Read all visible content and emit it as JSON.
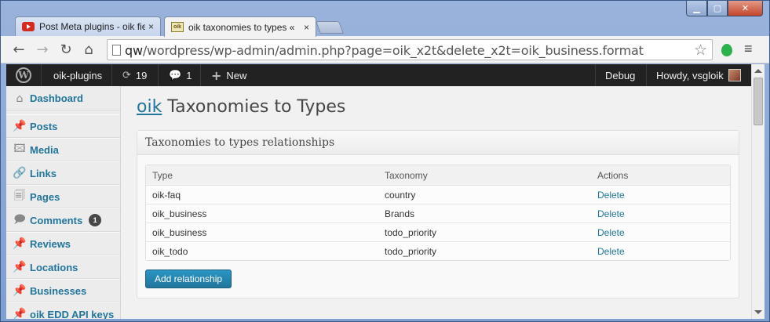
{
  "browser": {
    "tabs": [
      {
        "title": "Post Meta plugins - oik fie",
        "close": "×"
      },
      {
        "title": "oik taxonomies to types « ",
        "close": "×"
      }
    ],
    "window_controls": {
      "minimize": "▁",
      "maximize": "▢",
      "close": "✕"
    },
    "nav": {
      "back": "←",
      "forward": "→",
      "reload": "↻",
      "home": "⌂"
    },
    "address": {
      "host": "qw",
      "path": "/wordpress/wp-admin/admin.php?page=oik_x2t&delete_x2t=oik_business.format"
    },
    "star": "☆",
    "menu": "≡",
    "favicon_oik": "oik"
  },
  "adminbar": {
    "wp_logo": "W",
    "site_name": "oik-plugins",
    "updates_icon": "⟳",
    "updates_count": "19",
    "comments_icon": "💬",
    "comments_count": "1",
    "new_icon": "+",
    "new_label": "New",
    "debug": "Debug",
    "howdy": "Howdy, vsgloik"
  },
  "sidebar": {
    "items": [
      {
        "label": "Dashboard",
        "icon": "⌂"
      },
      {
        "label": "Posts",
        "icon": "📌"
      },
      {
        "label": "Media",
        "icon": "🖾"
      },
      {
        "label": "Links",
        "icon": "🔗"
      },
      {
        "label": "Pages",
        "icon": "🗐"
      },
      {
        "label": "Comments",
        "icon": "🗩",
        "badge": "1"
      },
      {
        "label": "Reviews",
        "icon": "📌"
      },
      {
        "label": "Locations",
        "icon": "📌"
      },
      {
        "label": "Businesses",
        "icon": "📌"
      },
      {
        "label": "oik EDD API keys",
        "icon": "📌"
      }
    ]
  },
  "main": {
    "title_link": "oik",
    "title_rest": " Taxonomies to Types",
    "box_title": "Taxonomies to types relationships",
    "table": {
      "headers": [
        "Type",
        "Taxonomy",
        "Actions"
      ],
      "rows": [
        {
          "type": "oik-faq",
          "taxonomy": "country",
          "action": "Delete"
        },
        {
          "type": "oik_business",
          "taxonomy": "Brands",
          "action": "Delete"
        },
        {
          "type": "oik_business",
          "taxonomy": "todo_priority",
          "action": "Delete"
        },
        {
          "type": "oik_todo",
          "taxonomy": "todo_priority",
          "action": "Delete"
        }
      ]
    },
    "add_button": "Add relationship"
  },
  "colors": {
    "link": "#21759b",
    "adminbar_bg": "#222222",
    "button_bg": "#21759b",
    "window_frame": "#7f9fd0"
  }
}
